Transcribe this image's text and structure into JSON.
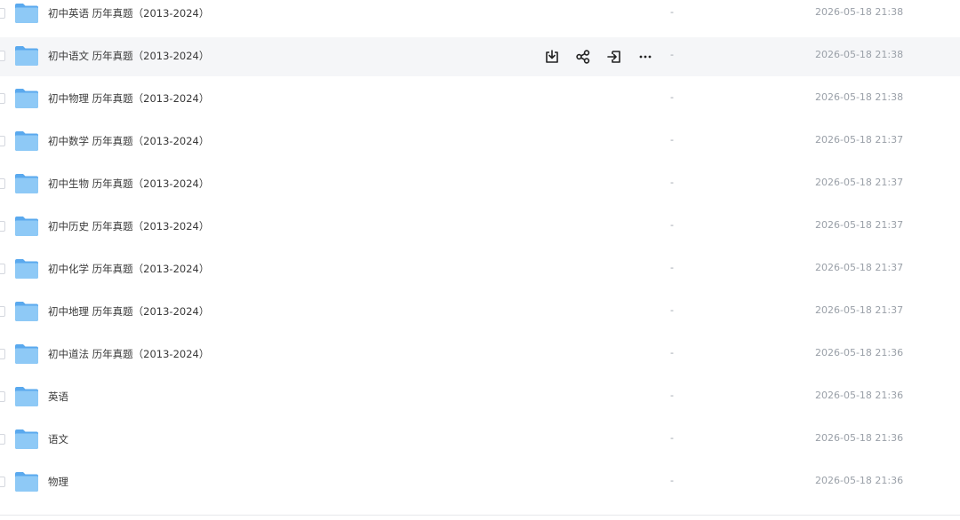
{
  "files": [
    {
      "name": "初中英语 历年真题（2013-2024）",
      "size": "-",
      "time": "2026-05-18 21:38"
    },
    {
      "name": "初中语文 历年真题（2013-2024）",
      "size": "-",
      "time": "2026-05-18 21:38"
    },
    {
      "name": "初中物理 历年真题（2013-2024）",
      "size": "-",
      "time": "2026-05-18 21:38"
    },
    {
      "name": "初中数学 历年真题（2013-2024）",
      "size": "-",
      "time": "2026-05-18 21:37"
    },
    {
      "name": "初中生物 历年真题（2013-2024）",
      "size": "-",
      "time": "2026-05-18 21:37"
    },
    {
      "name": "初中历史 历年真题（2013-2024）",
      "size": "-",
      "time": "2026-05-18 21:37"
    },
    {
      "name": "初中化学 历年真题（2013-2024）",
      "size": "-",
      "time": "2026-05-18 21:37"
    },
    {
      "name": "初中地理 历年真题（2013-2024）",
      "size": "-",
      "time": "2026-05-18 21:37"
    },
    {
      "name": "初中道法 历年真题（2013-2024）",
      "size": "-",
      "time": "2026-05-18 21:36"
    },
    {
      "name": "英语",
      "size": "-",
      "time": "2026-05-18 21:36"
    },
    {
      "name": "语文",
      "size": "-",
      "time": "2026-05-18 21:36"
    },
    {
      "name": "物理",
      "size": "-",
      "time": "2026-05-18 21:36"
    }
  ],
  "hovered_row_index": 1,
  "row_actions": [
    "download-icon",
    "share-icon",
    "move-icon",
    "more-icon"
  ],
  "colors": {
    "folder_light": "#8ec9f6",
    "folder_dark": "#5aa9ee",
    "hover_bg": "#f5f6f8",
    "meta_text": "#9aa0a8"
  }
}
